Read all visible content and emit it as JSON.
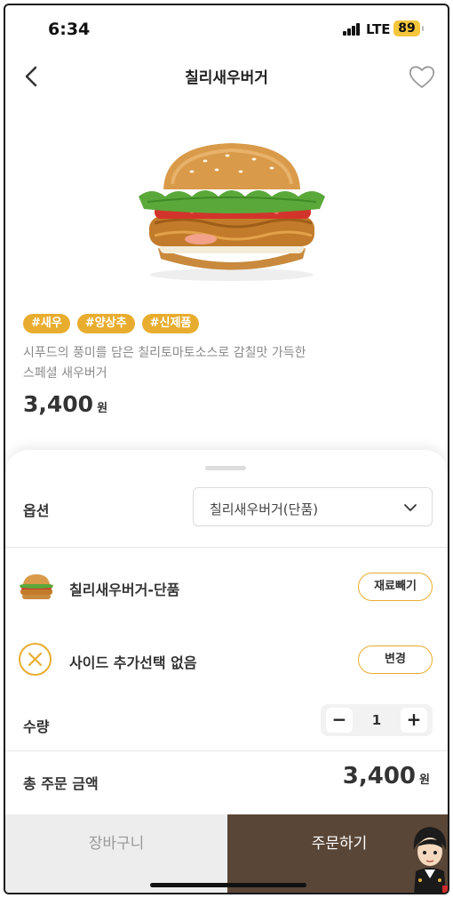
{
  "status_bar": {
    "time": "6:34",
    "network": "LTE",
    "battery": "89"
  },
  "header": {
    "title": "칠리새우버거",
    "back_icon": "chevron-left-icon",
    "favorite_icon": "heart-outline-icon"
  },
  "product": {
    "image": "burger-image",
    "tags": [
      "#새우",
      "#양상추",
      "#신제품"
    ],
    "description_lines": [
      "시푸드의 풍미를 담은 칠리토마토소스로 감칠맛 가득한",
      "스페셜 새우버거"
    ],
    "price": "3,400",
    "price_unit": "원"
  },
  "sheet": {
    "option_label": "옵션",
    "option_selected": "칠리새우버거(단품)",
    "item_name": "칠리새우버거-단품",
    "remove_ingredient_label": "재료빼기",
    "side_label": "사이드 추가선택 없음",
    "change_label": "변경",
    "quantity_label": "수량",
    "quantity_value": "1",
    "minus_label": "−",
    "plus_label": "+",
    "total_label": "총 주문 금액",
    "total_price": "3,400",
    "total_unit": "원"
  },
  "actions": {
    "cart_label": "장바구니",
    "order_label": "주문하기"
  },
  "colors": {
    "accent": "#e8ad2f",
    "order_button": "#5a4637",
    "cart_button": "#ededed"
  }
}
